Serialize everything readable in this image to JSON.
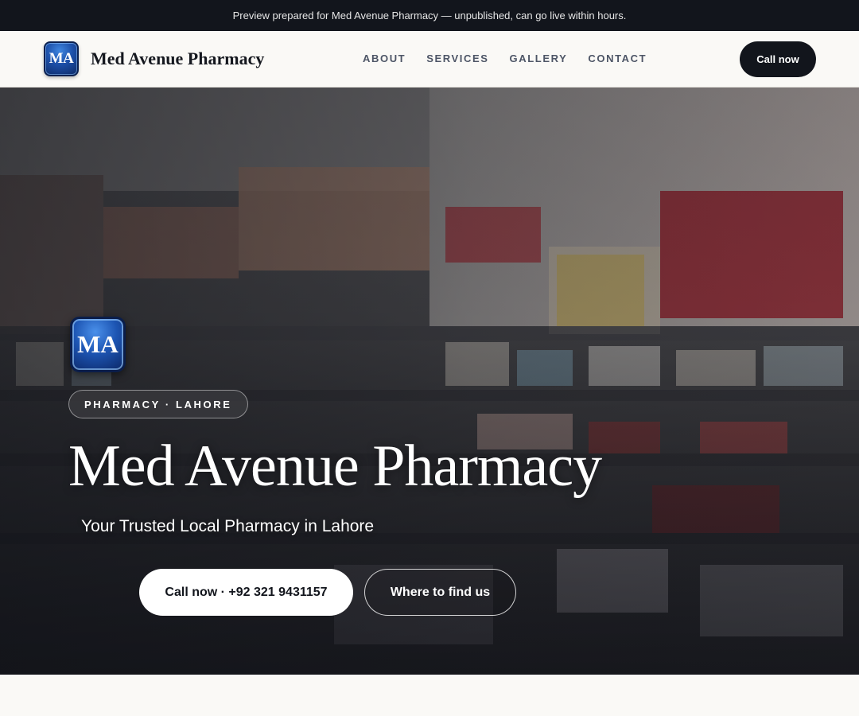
{
  "preview_banner": {
    "text": "Preview prepared for Med Avenue Pharmacy — unpublished, can go live within hours."
  },
  "header": {
    "logo_monogram": "MA",
    "brand_name": "Med Avenue Pharmacy",
    "nav": [
      {
        "label": "ABOUT"
      },
      {
        "label": "SERVICES"
      },
      {
        "label": "GALLERY"
      },
      {
        "label": "CONTACT"
      }
    ],
    "call_button": "Call now"
  },
  "hero": {
    "logo_monogram": "MA",
    "badge": "PHARMACY · LAHORE",
    "title": "Med Avenue Pharmacy",
    "subtitle": "Your Trusted Local Pharmacy in Lahore",
    "call_button": "Call now · +92 321 9431157",
    "find_button": "Where to find us",
    "background_image": "pharmacy-storefront-photo"
  },
  "colors": {
    "banner_bg": "#12151c",
    "page_bg": "#faf9f6",
    "primary_dark": "#12151c",
    "logo_blue": "#1c4fa8",
    "nav_text": "#4d5566"
  }
}
